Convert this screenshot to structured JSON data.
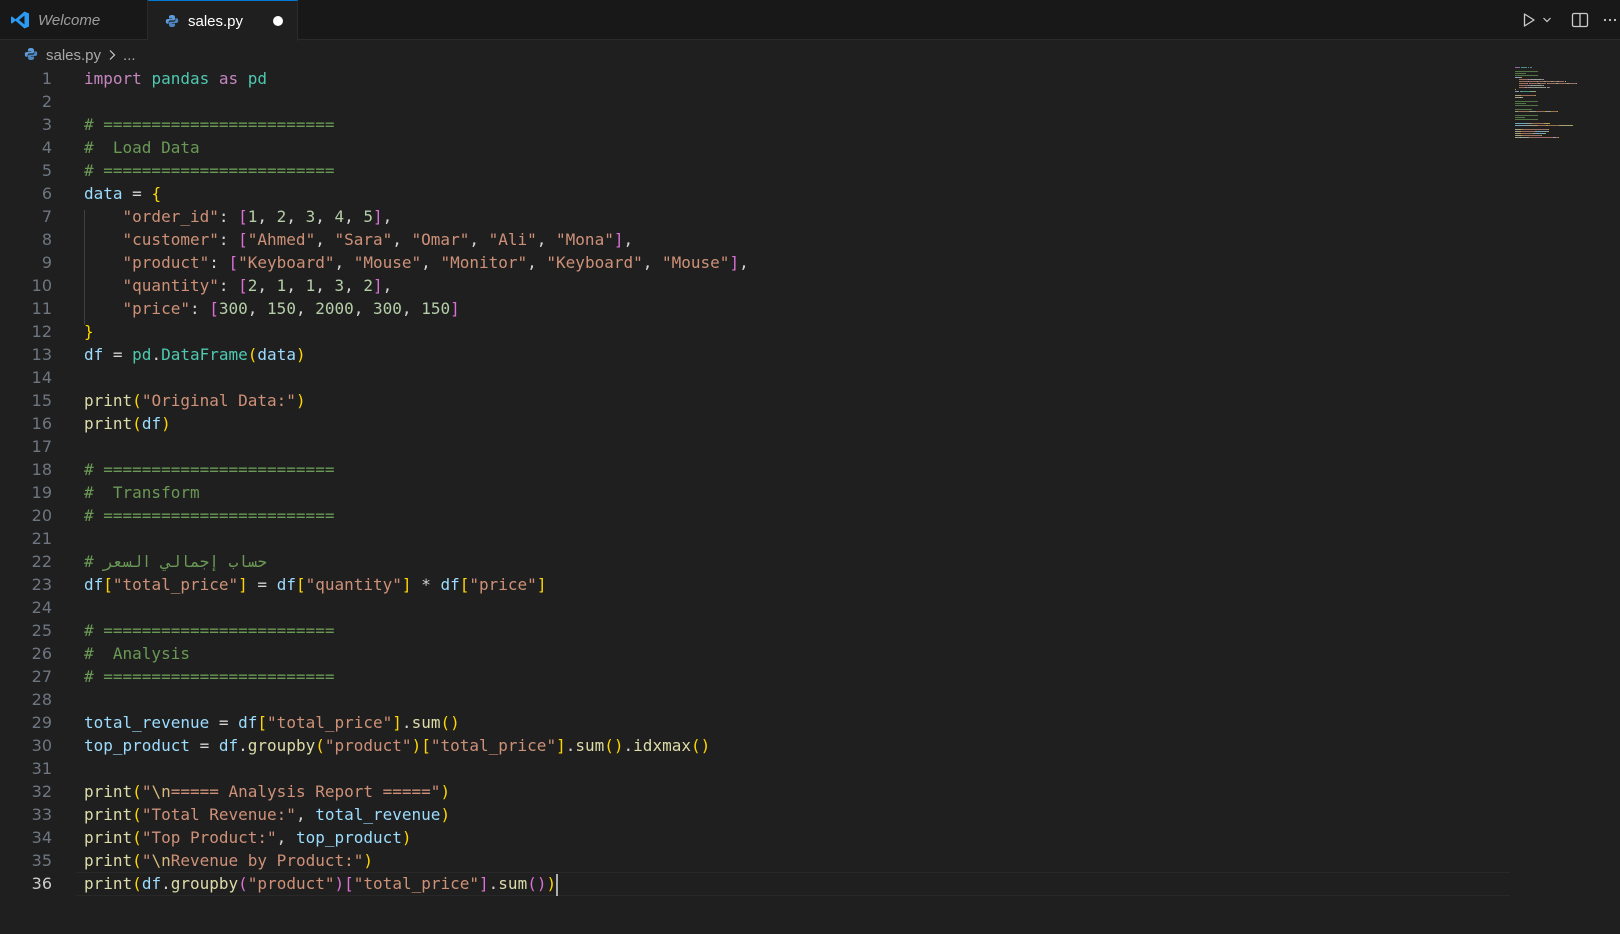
{
  "tabs": [
    {
      "label": "Welcome",
      "icon": "vscode-logo-icon"
    },
    {
      "label": "sales.py",
      "icon": "python-file-icon",
      "active": true,
      "dirty": true
    }
  ],
  "breadcrumb": {
    "file": "sales.py",
    "rest": "..."
  },
  "current_line": 36,
  "lines": [
    [
      [
        "kw",
        "import"
      ],
      [
        "op",
        " "
      ],
      [
        "mod",
        "pandas"
      ],
      [
        "op",
        " "
      ],
      [
        "kw",
        "as"
      ],
      [
        "op",
        " "
      ],
      [
        "mod",
        "pd"
      ]
    ],
    [],
    [
      [
        "cmt",
        "# ========================"
      ]
    ],
    [
      [
        "cmt",
        "#  Load Data"
      ]
    ],
    [
      [
        "cmt",
        "# ========================"
      ]
    ],
    [
      [
        "var",
        "data"
      ],
      [
        "op",
        " = "
      ],
      [
        "p1",
        "{"
      ]
    ],
    [
      [
        "op",
        "    "
      ],
      [
        "str",
        "\"order_id\""
      ],
      [
        "op",
        ": "
      ],
      [
        "p2",
        "["
      ],
      [
        "num",
        "1"
      ],
      [
        "op",
        ", "
      ],
      [
        "num",
        "2"
      ],
      [
        "op",
        ", "
      ],
      [
        "num",
        "3"
      ],
      [
        "op",
        ", "
      ],
      [
        "num",
        "4"
      ],
      [
        "op",
        ", "
      ],
      [
        "num",
        "5"
      ],
      [
        "p2",
        "]"
      ],
      [
        "op",
        ","
      ]
    ],
    [
      [
        "op",
        "    "
      ],
      [
        "str",
        "\"customer\""
      ],
      [
        "op",
        ": "
      ],
      [
        "p2",
        "["
      ],
      [
        "str",
        "\"Ahmed\""
      ],
      [
        "op",
        ", "
      ],
      [
        "str",
        "\"Sara\""
      ],
      [
        "op",
        ", "
      ],
      [
        "str",
        "\"Omar\""
      ],
      [
        "op",
        ", "
      ],
      [
        "str",
        "\"Ali\""
      ],
      [
        "op",
        ", "
      ],
      [
        "str",
        "\"Mona\""
      ],
      [
        "p2",
        "]"
      ],
      [
        "op",
        ","
      ]
    ],
    [
      [
        "op",
        "    "
      ],
      [
        "str",
        "\"product\""
      ],
      [
        "op",
        ": "
      ],
      [
        "p2",
        "["
      ],
      [
        "str",
        "\"Keyboard\""
      ],
      [
        "op",
        ", "
      ],
      [
        "str",
        "\"Mouse\""
      ],
      [
        "op",
        ", "
      ],
      [
        "str",
        "\"Monitor\""
      ],
      [
        "op",
        ", "
      ],
      [
        "str",
        "\"Keyboard\""
      ],
      [
        "op",
        ", "
      ],
      [
        "str",
        "\"Mouse\""
      ],
      [
        "p2",
        "]"
      ],
      [
        "op",
        ","
      ]
    ],
    [
      [
        "op",
        "    "
      ],
      [
        "str",
        "\"quantity\""
      ],
      [
        "op",
        ": "
      ],
      [
        "p2",
        "["
      ],
      [
        "num",
        "2"
      ],
      [
        "op",
        ", "
      ],
      [
        "num",
        "1"
      ],
      [
        "op",
        ", "
      ],
      [
        "num",
        "1"
      ],
      [
        "op",
        ", "
      ],
      [
        "num",
        "3"
      ],
      [
        "op",
        ", "
      ],
      [
        "num",
        "2"
      ],
      [
        "p2",
        "]"
      ],
      [
        "op",
        ","
      ]
    ],
    [
      [
        "op",
        "    "
      ],
      [
        "str",
        "\"price\""
      ],
      [
        "op",
        ": "
      ],
      [
        "p2",
        "["
      ],
      [
        "num",
        "300"
      ],
      [
        "op",
        ", "
      ],
      [
        "num",
        "150"
      ],
      [
        "op",
        ", "
      ],
      [
        "num",
        "2000"
      ],
      [
        "op",
        ", "
      ],
      [
        "num",
        "300"
      ],
      [
        "op",
        ", "
      ],
      [
        "num",
        "150"
      ],
      [
        "p2",
        "]"
      ]
    ],
    [
      [
        "p1",
        "}"
      ]
    ],
    [
      [
        "var",
        "df"
      ],
      [
        "op",
        " = "
      ],
      [
        "mod",
        "pd"
      ],
      [
        "op",
        "."
      ],
      [
        "mod",
        "DataFrame"
      ],
      [
        "p1",
        "("
      ],
      [
        "var",
        "data"
      ],
      [
        "p1",
        ")"
      ]
    ],
    [],
    [
      [
        "fn",
        "print"
      ],
      [
        "p1",
        "("
      ],
      [
        "str",
        "\"Original Data:\""
      ],
      [
        "p1",
        ")"
      ]
    ],
    [
      [
        "fn",
        "print"
      ],
      [
        "p1",
        "("
      ],
      [
        "var",
        "df"
      ],
      [
        "p1",
        ")"
      ]
    ],
    [],
    [
      [
        "cmt",
        "# ========================"
      ]
    ],
    [
      [
        "cmt",
        "#  Transform"
      ]
    ],
    [
      [
        "cmt",
        "# ========================"
      ]
    ],
    [],
    [
      [
        "cmt",
        "# حساب إجمالي السعر"
      ]
    ],
    [
      [
        "var",
        "df"
      ],
      [
        "p1",
        "["
      ],
      [
        "str",
        "\"total_price\""
      ],
      [
        "p1",
        "]"
      ],
      [
        "op",
        " = "
      ],
      [
        "var",
        "df"
      ],
      [
        "p1",
        "["
      ],
      [
        "str",
        "\"quantity\""
      ],
      [
        "p1",
        "]"
      ],
      [
        "op",
        " * "
      ],
      [
        "var",
        "df"
      ],
      [
        "p1",
        "["
      ],
      [
        "str",
        "\"price\""
      ],
      [
        "p1",
        "]"
      ]
    ],
    [],
    [
      [
        "cmt",
        "# ========================"
      ]
    ],
    [
      [
        "cmt",
        "#  Analysis"
      ]
    ],
    [
      [
        "cmt",
        "# ========================"
      ]
    ],
    [],
    [
      [
        "var",
        "total_revenue"
      ],
      [
        "op",
        " = "
      ],
      [
        "var",
        "df"
      ],
      [
        "p1",
        "["
      ],
      [
        "str",
        "\"total_price\""
      ],
      [
        "p1",
        "]"
      ],
      [
        "op",
        "."
      ],
      [
        "fn",
        "sum"
      ],
      [
        "p1",
        "()"
      ]
    ],
    [
      [
        "var",
        "top_product"
      ],
      [
        "op",
        " = "
      ],
      [
        "var",
        "df"
      ],
      [
        "op",
        "."
      ],
      [
        "fn",
        "groupby"
      ],
      [
        "p1",
        "("
      ],
      [
        "str",
        "\"product\""
      ],
      [
        "p1",
        ")"
      ],
      [
        "p1",
        "["
      ],
      [
        "str",
        "\"total_price\""
      ],
      [
        "p1",
        "]"
      ],
      [
        "op",
        "."
      ],
      [
        "fn",
        "sum"
      ],
      [
        "p1",
        "()"
      ],
      [
        "op",
        "."
      ],
      [
        "fn",
        "idxmax"
      ],
      [
        "p1",
        "()"
      ]
    ],
    [],
    [
      [
        "fn",
        "print"
      ],
      [
        "p1",
        "("
      ],
      [
        "str",
        "\""
      ],
      [
        "esc",
        "\\n"
      ],
      [
        "str",
        "===== Analysis Report =====\""
      ],
      [
        "p1",
        ")"
      ]
    ],
    [
      [
        "fn",
        "print"
      ],
      [
        "p1",
        "("
      ],
      [
        "str",
        "\"Total Revenue:\""
      ],
      [
        "op",
        ", "
      ],
      [
        "var",
        "total_revenue"
      ],
      [
        "p1",
        ")"
      ]
    ],
    [
      [
        "fn",
        "print"
      ],
      [
        "p1",
        "("
      ],
      [
        "str",
        "\"Top Product:\""
      ],
      [
        "op",
        ", "
      ],
      [
        "var",
        "top_product"
      ],
      [
        "p1",
        ")"
      ]
    ],
    [
      [
        "fn",
        "print"
      ],
      [
        "p1",
        "("
      ],
      [
        "str",
        "\""
      ],
      [
        "esc",
        "\\n"
      ],
      [
        "str",
        "Revenue by Product:\""
      ],
      [
        "p1",
        ")"
      ]
    ],
    [
      [
        "fn",
        "print"
      ],
      [
        "p1",
        "("
      ],
      [
        "var",
        "df"
      ],
      [
        "op",
        "."
      ],
      [
        "fn",
        "groupby"
      ],
      [
        "p2",
        "("
      ],
      [
        "str",
        "\"product\""
      ],
      [
        "p2",
        ")"
      ],
      [
        "p2",
        "["
      ],
      [
        "str",
        "\"total_price\""
      ],
      [
        "p2",
        "]"
      ],
      [
        "op",
        "."
      ],
      [
        "fn",
        "sum"
      ],
      [
        "p2",
        "()"
      ],
      [
        "p1",
        ")"
      ]
    ]
  ],
  "colors": {
    "accent": "#0078d4",
    "background": "#1f1f1f",
    "tabbar": "#181818"
  }
}
